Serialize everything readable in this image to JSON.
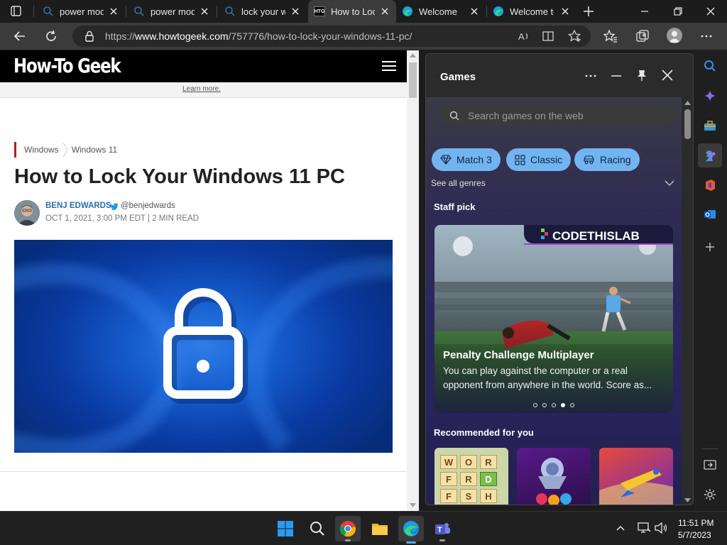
{
  "tabs": [
    {
      "title": "power mod",
      "icon": "search-icon",
      "active": false
    },
    {
      "title": "power mod",
      "icon": "search-icon",
      "active": false
    },
    {
      "title": "lock your w",
      "icon": "search-icon",
      "active": false
    },
    {
      "title": "How to Loc",
      "icon": "htg-favicon",
      "active": true
    },
    {
      "title": "Welcome",
      "icon": "edge-icon",
      "active": false
    },
    {
      "title": "Welcome to",
      "icon": "edge-icon",
      "active": false
    }
  ],
  "favicon_text": "HTG",
  "address": {
    "prefix": "https://",
    "domain": "www.howtogeek.com",
    "path": "/757776/how-to-lock-your-windows-11-pc/"
  },
  "page": {
    "logo": "How-To Geek",
    "learn_more": "Learn more.",
    "breadcrumbs": [
      "Windows",
      "Windows 11"
    ],
    "headline": "How to Lock Your Windows 11 PC",
    "author": "BENJ EDWARDS",
    "handle": "@benjedwards",
    "dateline": "OCT 1, 2021, 3:00 PM EDT | 2 MIN READ"
  },
  "games": {
    "title": "Games",
    "search_placeholder": "Search games on the web",
    "chips": [
      {
        "label": "Match 3",
        "icon": "diamond-icon"
      },
      {
        "label": "Classic",
        "icon": "grid-icon"
      },
      {
        "label": "Racing",
        "icon": "car-icon"
      }
    ],
    "see_all": "See all genres",
    "staff_pick": "Staff pick",
    "promo": {
      "brand": "CODETHISLAB",
      "title": "Penalty Challenge Multiplayer",
      "description": "You can play against the computer or a real opponent from anywhere in the world. Score as...",
      "dot_count": 5,
      "active_dot": 3
    },
    "recommended": "Recommended for you",
    "word_tiles": [
      "W",
      "O",
      "R",
      "F",
      "R",
      "D",
      "F",
      "S",
      "H"
    ]
  },
  "clock": {
    "time": "11:51 PM",
    "date": "5/7/2023"
  },
  "colors": {
    "accent_chip": "#72b4ef",
    "htg_red": "#c0181b",
    "link_blue": "#2c6db4"
  }
}
